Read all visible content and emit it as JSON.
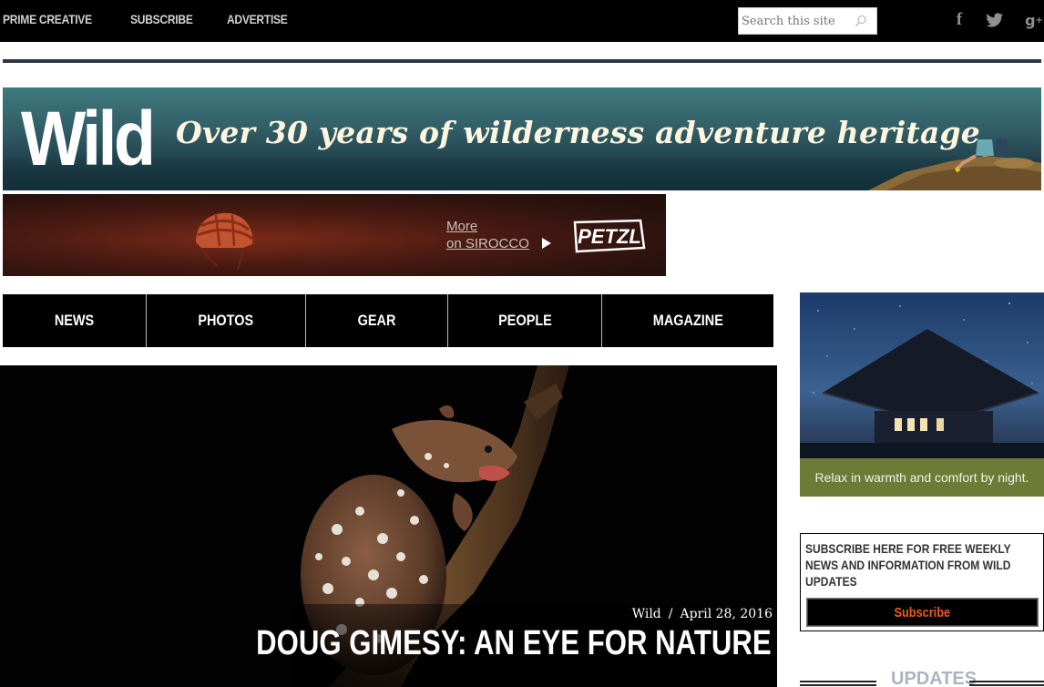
{
  "topbar": {
    "links": [
      "PRIME CREATIVE",
      "SUBSCRIBE",
      "ADVERTISE"
    ],
    "search_placeholder": "Search this site",
    "social_icons": [
      "facebook-icon",
      "twitter-icon",
      "google-plus-icon"
    ]
  },
  "banner": {
    "brand": "Wild",
    "tagline": "Over 30 years of wilderness adventure heritage"
  },
  "petzl_ad": {
    "more_line1": "More",
    "more_line2": "on SIROCCO",
    "brand": "PETZL"
  },
  "nav": {
    "items": [
      "NEWS",
      "PHOTOS",
      "GEAR",
      "PEOPLE",
      "MAGAZINE"
    ]
  },
  "hero": {
    "author": "Wild",
    "separator": "/",
    "date": "April 28, 2016",
    "title": "DOUG GIMESY: AN EYE FOR NATURE"
  },
  "sidebar": {
    "ad_caption": "Relax in warmth and comfort by night.",
    "subscribe_text": "SUBSCRIBE HERE FOR FREE WEEKLY NEWS AND INFORMATION FROM WILD UPDATES",
    "subscribe_button": "Subscribe",
    "updates_heading": "UPDATES"
  },
  "colors": {
    "topbar_bg": "#000000",
    "nav_bg": "#000000",
    "subscribe_button_text": "#ef5a1d",
    "ad_caption_bg": "#6d7b37",
    "rule": "#2d3640"
  }
}
